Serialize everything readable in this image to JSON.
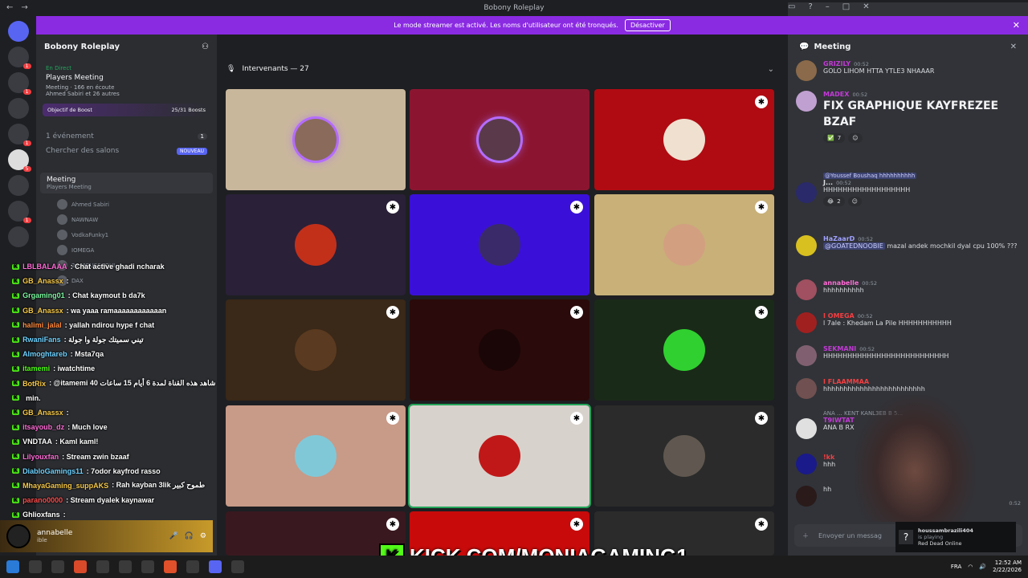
{
  "window": {
    "title": "Bobony Roleplay"
  },
  "banner": {
    "text": "Le mode streamer est activé. Les noms d'utilisateur ont été tronqués.",
    "button": "Désactiver"
  },
  "sidebar": {
    "guild_name": "Bobony Roleplay",
    "live_label": "En Direct",
    "event_title": "Players Meeting",
    "event_meta": "Meeting · 166 en écoute",
    "event_people": "Ahmed Sabiri et 26 autres",
    "boost_label": "Objectif de Boost",
    "boost_value": "25/31 Boosts",
    "events_label": "1 événement",
    "events_count": "1",
    "search_label": "Chercher des salons",
    "new_badge": "NOUVEAU",
    "voice_channel": "Meeting",
    "voice_sub": "Players Meeting",
    "voice_users": [
      "Ahmed Sabiri",
      "NAWNAW",
      "VodkaFunky1",
      "ΙΟΜΕGA",
      "24 MOUSSAOUI",
      "DAX"
    ]
  },
  "user": {
    "name": "annabelle",
    "sub": "ible"
  },
  "chat_overlay": [
    {
      "user": "LBLBALAAA",
      "text": ": Chat active ghadi ncharak",
      "color": "#ff6bd6"
    },
    {
      "user": "GB_Anassx",
      "text": ":",
      "color": "#f7c948"
    },
    {
      "user": "Grgaming01",
      "text": ": Chat kaymout b da7k",
      "color": "#7cf7a0"
    },
    {
      "user": "GB_Anassx",
      "text": ": wa yaaa ramaaaaaaaaaaaan",
      "color": "#f7c948"
    },
    {
      "user": "halimi_jalal",
      "text": ": yallah ndirou hype f chat",
      "color": "#ff8a3d"
    },
    {
      "user": "RwaniFans",
      "text": ": تيني سميتك جولة وا جولة",
      "color": "#6fd2ff"
    },
    {
      "user": "Almoghtareb",
      "text": ": Msta7qa",
      "color": "#6fd2ff"
    },
    {
      "user": "itamemi",
      "text": ": iwatchtime",
      "color": "#53fc18"
    },
    {
      "user": "BotRix",
      "text": ": @itamemi 40 شاهد هذه القناة لمدة 6 أيام 15 ساعات",
      "color": "#f7c948"
    },
    {
      "user": "",
      "text": "min.",
      "color": "#ffffff"
    },
    {
      "user": "GB_Anassx",
      "text": ":",
      "color": "#f7c948"
    },
    {
      "user": "itsayoub_dz",
      "text": ": Much love",
      "color": "#ff6bd6"
    },
    {
      "user": "VNDTAA",
      "text": ": Kaml kaml!",
      "color": "#ffffff"
    },
    {
      "user": "Lilyouxfan",
      "text": ": Stream zwin bzaaf",
      "color": "#ff6bd6"
    },
    {
      "user": "DiabloGamings11",
      "text": ": 7odor kayfrod rasso",
      "color": "#6fd2ff"
    },
    {
      "user": "MhayaGaming_suppAKS",
      "text": ": Rah kayban 3lik طموح كبير",
      "color": "#f7c948"
    },
    {
      "user": "parano0000",
      "text": ": Stream dyalek kaynawar",
      "color": "#ff4d4d"
    },
    {
      "user": "Ghlioxfans",
      "text": ":",
      "color": "#ffffff"
    }
  ],
  "stage": {
    "header": "Intervenants — 27"
  },
  "right_panel": {
    "title": "Meeting",
    "messages": [
      {
        "name": "GRIZILY",
        "time": "00:52",
        "text": "GOLO LIHOM HTTA YTLE3 NHAAAR",
        "color": "#c23ad6"
      },
      {
        "name": "MADEX",
        "time": "00:52",
        "text": "FIX GRAPHIQUE KAYFREZEE BZAF",
        "color": "#c23ad6",
        "reaction": "7"
      },
      {
        "name": "J...",
        "time": "00:52",
        "reply": "@Youssef Boushaq hhhhhhhhhh",
        "text": "HHHHHHHHHHHHHHHHHH",
        "color": "#ffffff",
        "reaction": "2"
      },
      {
        "name": "HaZaarD",
        "time": "00:52",
        "mention": "@GOATEDNOOBIE",
        "text": "mazal andek mochkil dyal cpu 100% ???",
        "color": "#a0a0ff"
      },
      {
        "name": "annabelle",
        "time": "00:52",
        "text": "hhhhhhhhhh",
        "color": "#ff6bd6"
      },
      {
        "name": "Ι ΟΜΕGA",
        "time": "00:52",
        "text": "l 7ale : Khedam La Pile HHHHHHHHHHH",
        "color": "#f23f42"
      },
      {
        "name": "SEKMANI",
        "time": "00:52",
        "text": "HHHHHHHHHHHHHHHHHHHHHHHHHH",
        "color": "#c23ad6"
      },
      {
        "name": "I FLAAMMAA",
        "time": "",
        "text": "hhhhhhhhhhhhhhhhhhhhhhhhh",
        "color": "#f23f42"
      },
      {
        "name": "T9IWTAT",
        "time": "",
        "reply": "ANA ... KENT KANL3EB B 5...",
        "text": "ANA B RX",
        "color": "#c23ad6"
      },
      {
        "name": "!kk",
        "time": "",
        "text": "hhh",
        "color": "#f23f42"
      },
      {
        "name": "",
        "time": "0:52",
        "text": "hh",
        "color": "#f23f42"
      }
    ],
    "input_placeholder": "Envoyer un messag"
  },
  "game_toast": {
    "user": "houssambrazili404",
    "status": "is playing",
    "game": "Red Dead Online"
  },
  "kick_url": "KICK.COM/MONIAGAMING1",
  "taskbar": {
    "lang": "FRA",
    "time": "12:52 AM",
    "date": "2/22/2026"
  }
}
